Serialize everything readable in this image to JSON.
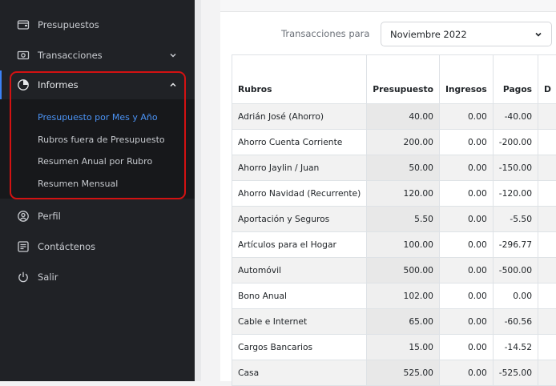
{
  "sidebar": {
    "items": [
      {
        "label": "Presupuestos",
        "icon": "wallet-icon"
      },
      {
        "label": "Transacciones",
        "icon": "money-icon",
        "has_chevron": true
      },
      {
        "label": "Informes",
        "icon": "pie-chart-icon",
        "expanded": true
      },
      {
        "label": "Perfil",
        "icon": "user-circle-icon"
      },
      {
        "label": "Contáctenos",
        "icon": "contact-form-icon"
      },
      {
        "label": "Salir",
        "icon": "power-icon"
      }
    ],
    "submenu": [
      "Presupuesto por Mes y Año",
      "Rubros fuera de Presupuesto",
      "Resumen Anual por Rubro",
      "Resumen Mensual"
    ],
    "submenu_current": 0
  },
  "filter": {
    "label": "Transacciones para",
    "selected": "Noviembre 2022"
  },
  "table": {
    "headers": [
      "Rubros",
      "Presupuesto",
      "Ingresos",
      "Pagos",
      "D"
    ],
    "rows": [
      [
        "Adrián José (Ahorro)",
        "40.00",
        "0.00",
        "-40.00"
      ],
      [
        "Ahorro Cuenta Corriente",
        "200.00",
        "0.00",
        "-200.00"
      ],
      [
        "Ahorro Jaylin / Juan",
        "50.00",
        "0.00",
        "-150.00"
      ],
      [
        "Ahorro Navidad (Recurrente)",
        "120.00",
        "0.00",
        "-120.00"
      ],
      [
        "Aportación y Seguros",
        "5.50",
        "0.00",
        "-5.50"
      ],
      [
        "Artículos para el Hogar",
        "100.00",
        "0.00",
        "-296.77"
      ],
      [
        "Automóvil",
        "500.00",
        "0.00",
        "-500.00"
      ],
      [
        "Bono Anual",
        "102.00",
        "0.00",
        "0.00"
      ],
      [
        "Cable e Internet",
        "65.00",
        "0.00",
        "-60.56"
      ],
      [
        "Cargos Bancarios",
        "15.00",
        "0.00",
        "-14.52"
      ],
      [
        "Casa",
        "525.00",
        "0.00",
        "-525.00"
      ]
    ]
  },
  "colors": {
    "sidebar_bg": "#202226",
    "submenu_bg": "#17181b",
    "active_link": "#4b93f5",
    "highlight_border": "#d31212"
  }
}
